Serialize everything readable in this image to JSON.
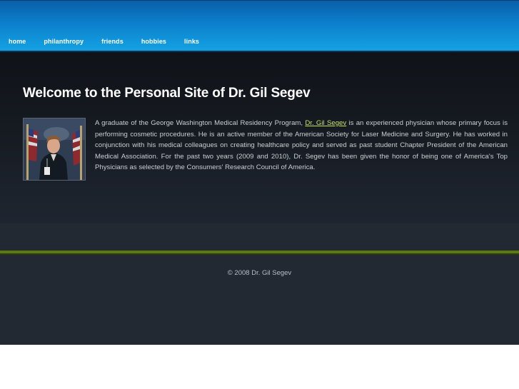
{
  "nav": {
    "items": [
      {
        "label": "home"
      },
      {
        "label": "philanthropy"
      },
      {
        "label": "friends"
      },
      {
        "label": "hobbies"
      },
      {
        "label": "links"
      }
    ]
  },
  "main": {
    "title": "Welcome to the Personal Site of Dr. Gil Segev",
    "bio_before_link": "A graduate of the George Washington Medical Residency Program, ",
    "bio_link": "Dr. Gil Segev",
    "bio_after_link": " is an experienced physician whose primary focus is performing cosmetic procedures. He is an active member of the American Society for Laser Medicine and Surgery. He has worked in conjunction with his medical colleagues on creating healthcare policy and served as past student Chapter President of the American Medical Association. For the past two years (2009 and 2010), Dr. Segev has been given the honor of being one of America's Top Physicians as selected by the Consumers' Research Council of America."
  },
  "footer": {
    "copyright": "© 2008 Dr. Gil Segev"
  },
  "colors": {
    "header_blue": "#0b7cc9",
    "link_green": "#c8e16a",
    "divider_green": "#5c7a12",
    "background_dark": "#161b22"
  }
}
